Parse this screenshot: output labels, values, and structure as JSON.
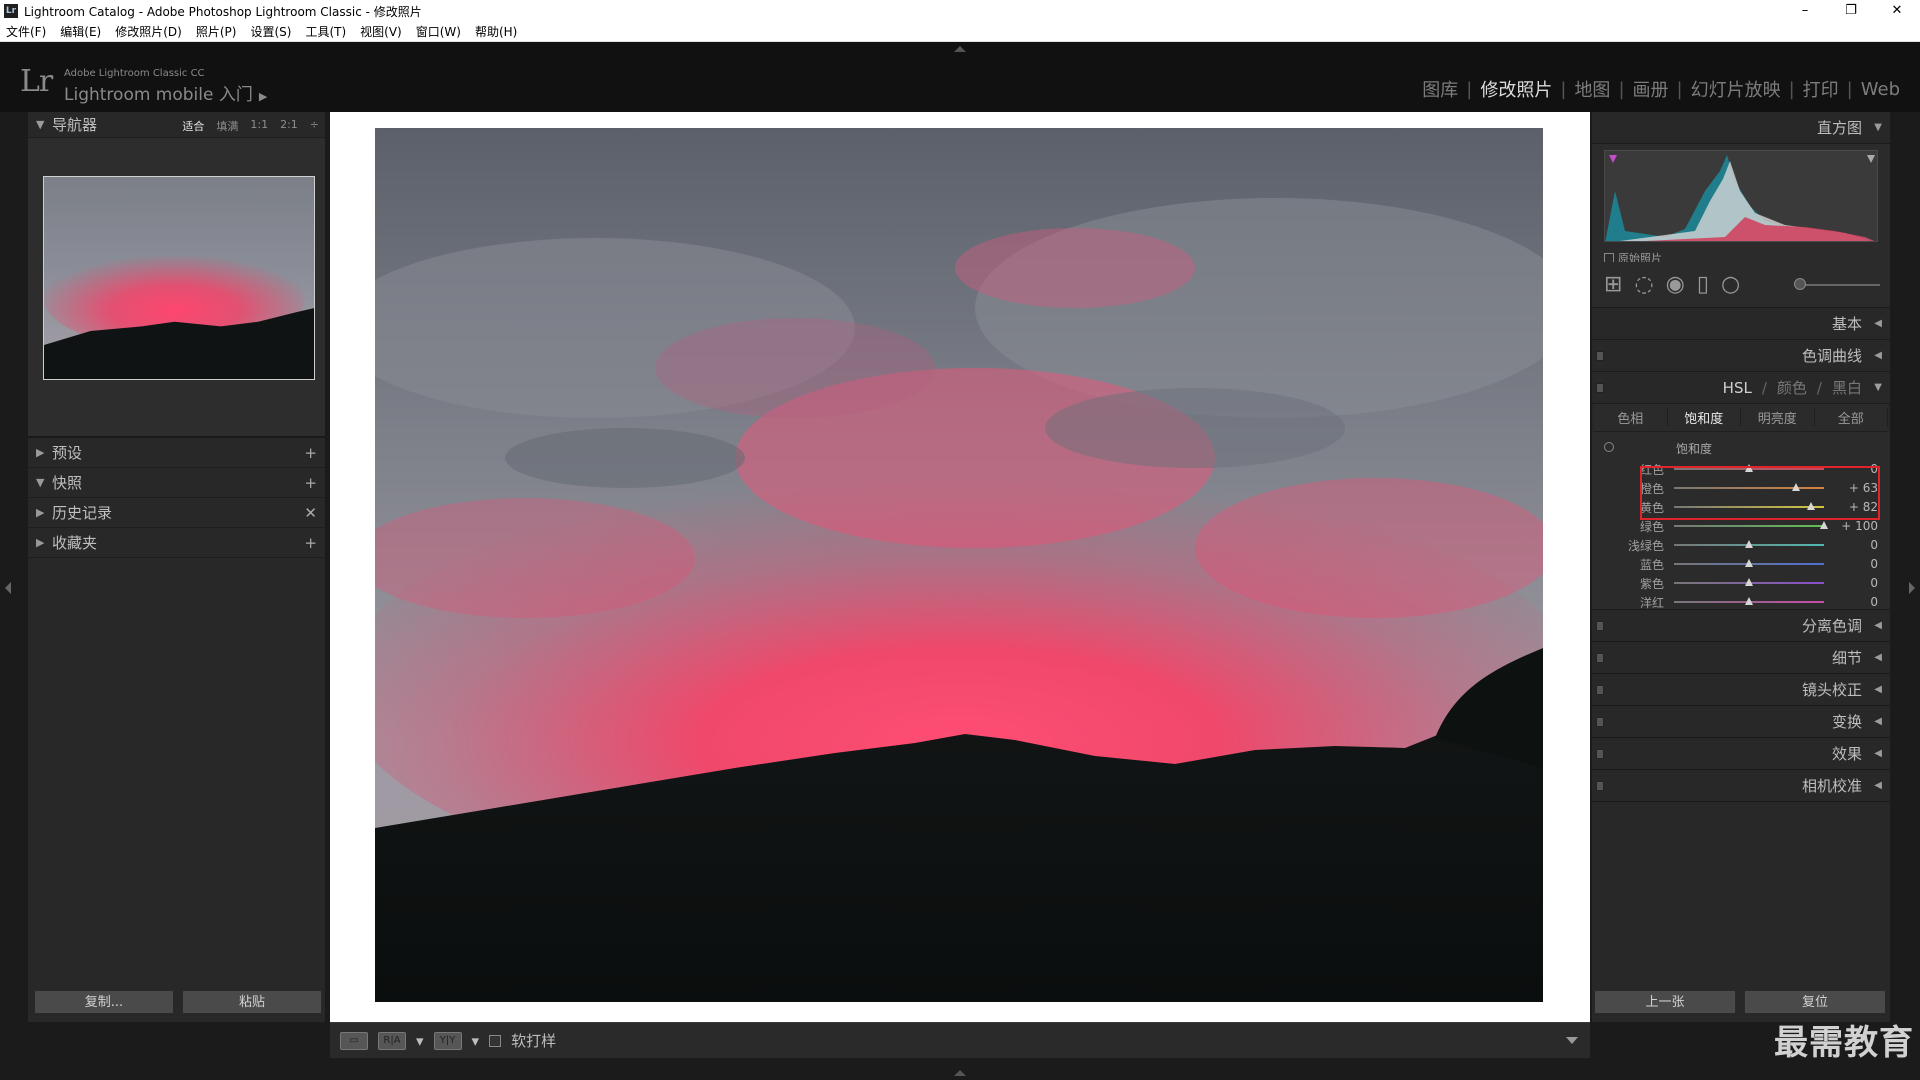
{
  "window": {
    "title": "Lightroom Catalog - Adobe Photoshop Lightroom Classic - 修改照片",
    "app_icon": "Lr",
    "minimize": "–",
    "restore": "❐",
    "close": "✕"
  },
  "menu": [
    "文件(F)",
    "编辑(E)",
    "修改照片(D)",
    "照片(P)",
    "设置(S)",
    "工具(T)",
    "视图(V)",
    "窗口(W)",
    "帮助(H)"
  ],
  "identity": {
    "logo": "Lr",
    "product": "Adobe Lightroom Classic CC",
    "mobile": "Lightroom mobile 入门",
    "arrow": "▶"
  },
  "modules": [
    {
      "label": "图库",
      "active": false
    },
    {
      "label": "修改照片",
      "active": true
    },
    {
      "label": "地图",
      "active": false
    },
    {
      "label": "画册",
      "active": false
    },
    {
      "label": "幻灯片放映",
      "active": false
    },
    {
      "label": "打印",
      "active": false
    },
    {
      "label": "Web",
      "active": false
    }
  ],
  "module_separator": "|",
  "left_panel": {
    "navigator": {
      "title": "导航器",
      "zoom": [
        "适合",
        "填满",
        "1:1",
        "2:1"
      ],
      "zoom_active": "适合",
      "zoom_more": "÷"
    },
    "sections": [
      {
        "title": "预设",
        "action": "+",
        "open": false
      },
      {
        "title": "快照",
        "action": "+",
        "open": true
      },
      {
        "title": "历史记录",
        "action": "✕",
        "open": false
      },
      {
        "title": "收藏夹",
        "action": "+",
        "open": false
      }
    ],
    "copy_button": "复制...",
    "paste_button": "粘贴"
  },
  "toolbar": {
    "view_single": "▭",
    "view_compare": "R|A",
    "view_before_after": "Y|Y",
    "dropdown": "▾",
    "soft_proof_label": "软打样"
  },
  "right_panel": {
    "histogram_title": "直方图",
    "original_photo": "原始照片",
    "basic": "基本",
    "tone_curve": "色调曲线",
    "hsl_header": [
      "HSL",
      "颜色",
      "黑白"
    ],
    "hsl_separator": "/",
    "hsl_tabs": [
      "色相",
      "饱和度",
      "明亮度",
      "全部"
    ],
    "hsl_active_tab": "饱和度",
    "saturation_title": "饱和度",
    "sliders": [
      {
        "label": "红色",
        "value": 0,
        "display": "0",
        "color": "#c8485c"
      },
      {
        "label": "橙色",
        "value": 63,
        "display": "+ 63",
        "color": "#d7823b"
      },
      {
        "label": "黄色",
        "value": 82,
        "display": "+ 82",
        "color": "#d5c63d"
      },
      {
        "label": "绿色",
        "value": 100,
        "display": "+ 100",
        "color": "#5fbf55"
      },
      {
        "label": "浅绿色",
        "value": 0,
        "display": "0",
        "color": "#52b8b0"
      },
      {
        "label": "蓝色",
        "value": 0,
        "display": "0",
        "color": "#4f6fd0"
      },
      {
        "label": "紫色",
        "value": 0,
        "display": "0",
        "color": "#8a4fcb"
      },
      {
        "label": "洋红",
        "value": 0,
        "display": "0",
        "color": "#c54ba8"
      }
    ],
    "collapsed_panels": [
      "分离色调",
      "细节",
      "镜头校正",
      "变换",
      "效果",
      "相机校准"
    ],
    "prev_button": "上一张",
    "reset_button": "复位"
  },
  "watermark": "最需教育",
  "colors": {
    "accent_highlight": "#e0242a",
    "sky_pink": "#f0456a"
  }
}
